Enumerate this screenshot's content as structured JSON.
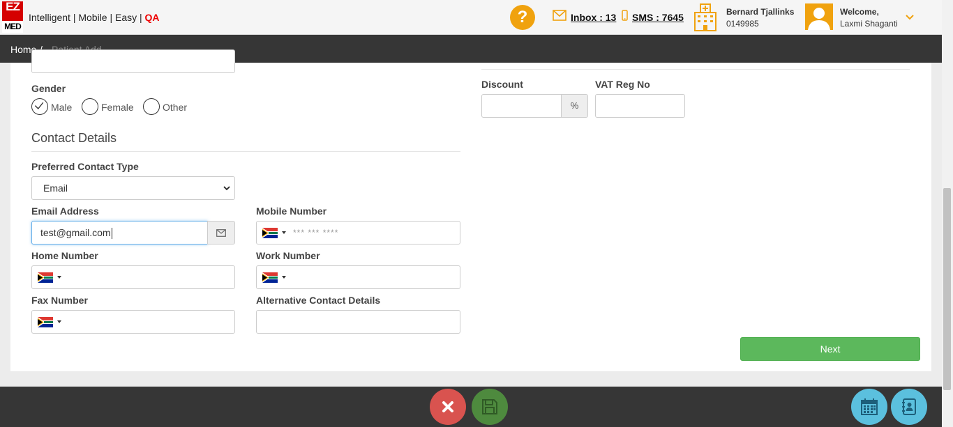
{
  "header": {
    "logo_top": "EZ",
    "logo_bottom": "MED",
    "tagline": "Intelligent | Mobile | Easy | ",
    "env": "QA",
    "help": "?",
    "inbox": "Inbox : 13",
    "sms": "SMS : 7645",
    "practice_name": "Bernard Tjallinks",
    "practice_number": "0149985",
    "welcome": "Welcome,",
    "user_name": "Laxmi Shaganti"
  },
  "breadcrumb": {
    "home": "Home",
    "separator": "/",
    "current": "Patient Add"
  },
  "form": {
    "gender_label": "Gender",
    "gender_options": [
      "Male",
      "Female",
      "Other"
    ],
    "gender_selected": "Male",
    "contact_section_title": "Contact Details",
    "preferred_contact_label": "Preferred Contact Type",
    "preferred_contact_value": "Email",
    "email_label": "Email Address",
    "email_value": "test@gmail.com",
    "mobile_label": "Mobile Number",
    "mobile_placeholder": "*** *** ****",
    "home_label": "Home Number",
    "work_label": "Work Number",
    "fax_label": "Fax Number",
    "alt_contact_label": "Alternative Contact Details",
    "discount_label": "Discount",
    "discount_unit": "%",
    "vat_label": "VAT Reg No",
    "next_label": "Next"
  },
  "colors": {
    "brand_red": "#d50000",
    "accent_orange": "#f0a20e",
    "dark_bar": "#363636",
    "success_green": "#5cb85c",
    "danger_red": "#d9534f",
    "info_blue": "#5bc0de"
  },
  "icons": {
    "help": "question-icon",
    "mail": "envelope-icon",
    "phone": "mobile-phone-icon",
    "practice": "hospital-icon",
    "cancel": "close-icon",
    "save": "floppy-disk-icon",
    "calendar": "calendar-icon",
    "contacts": "address-book-icon",
    "flag": "south-africa-flag-icon"
  }
}
